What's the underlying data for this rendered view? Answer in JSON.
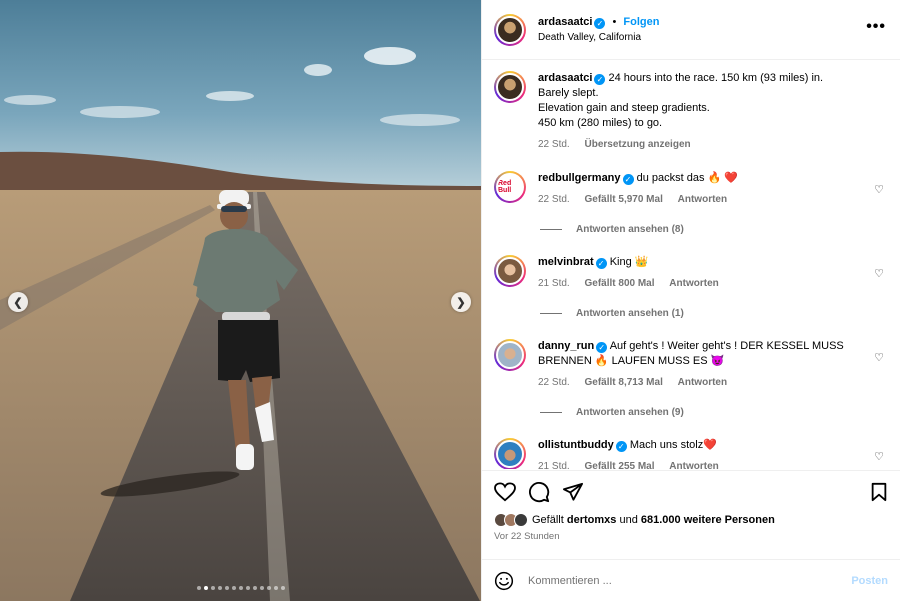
{
  "post": {
    "author": "ardasaatci",
    "follow_label": "Folgen",
    "bullet": "•",
    "location": "Death Valley, California",
    "more_label": "•••",
    "caption_lines": [
      "24 hours into the race. 150 km (93 miles) in.",
      "Barely slept.",
      "Elevation gain and steep gradients.",
      "450 km (280 miles) to go."
    ],
    "caption_time": "22 Std.",
    "translate_label": "Übersetzung anzeigen",
    "image_dots": 13,
    "image_active_dot": 1
  },
  "comments": [
    {
      "user": "redbullgermany",
      "text": "du packst das 🔥 ❤️",
      "time": "22 Std.",
      "likes": "Gefällt 5,970 Mal",
      "reply": "Antworten",
      "replies": "Antworten ansehen (8)"
    },
    {
      "user": "melvinbrat",
      "text": "King 👑",
      "time": "21 Std.",
      "likes": "Gefällt 800 Mal",
      "reply": "Antworten",
      "replies": "Antworten ansehen (1)"
    },
    {
      "user": "danny_run",
      "text": "Auf geht's ! Weiter geht's ! DER KESSEL MUSS BRENNEN 🔥 LAUFEN MUSS ES 😈",
      "time": "22 Std.",
      "likes": "Gefällt 8,713 Mal",
      "reply": "Antworten",
      "replies": "Antworten ansehen (9)"
    },
    {
      "user": "ollistuntbuddy",
      "text": "Mach uns stolz❤️",
      "time": "21 Std.",
      "likes": "Gefällt 255 Mal",
      "reply": "Antworten"
    }
  ],
  "likes": {
    "prefix": "Gefällt",
    "user": "dertomxs",
    "middle": "und",
    "count": "681.000 weitere Personen"
  },
  "timestamp": "Vor 22 Stunden",
  "comment_box": {
    "placeholder": "Kommentieren ...",
    "post_label": "Posten"
  },
  "icons": {
    "like": "heart-icon",
    "comment": "comment-icon",
    "share": "share-icon",
    "save": "bookmark-icon",
    "emoji": "emoji-icon"
  },
  "colors": {
    "accent": "#0095f6",
    "muted": "#737373",
    "post_disabled": "#b3dbff"
  }
}
